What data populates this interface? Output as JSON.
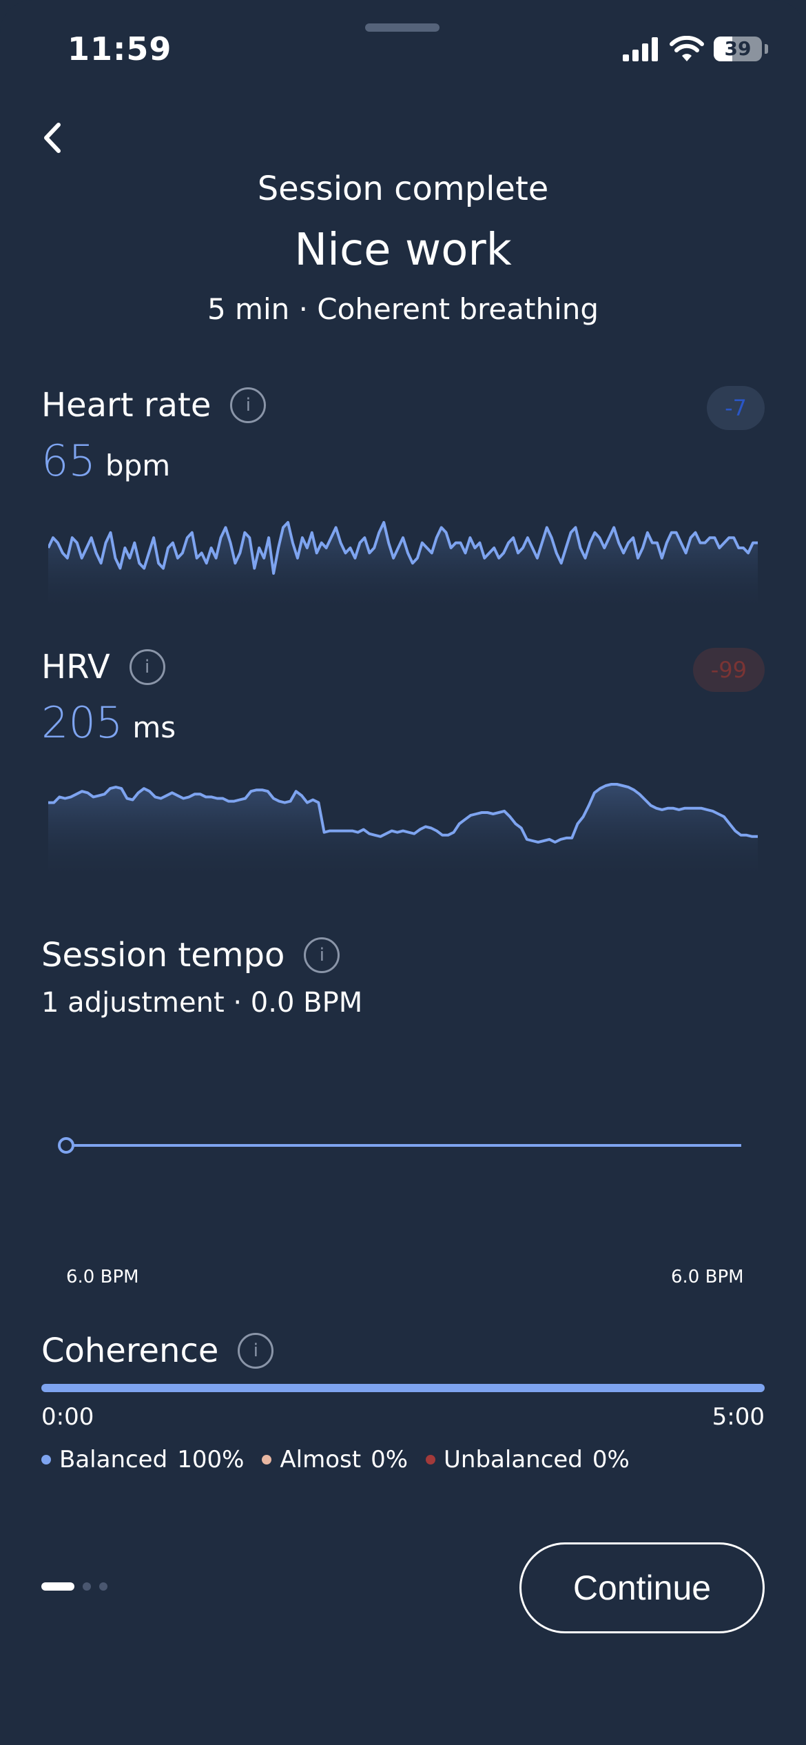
{
  "status_bar": {
    "time": "11:59",
    "battery": "39",
    "battery_level": 0.39
  },
  "header": {
    "line1": "Session complete",
    "title": "Nice work",
    "subtitle": "5 min · Coherent breathing"
  },
  "heart_rate": {
    "title": "Heart rate",
    "delta": "-7",
    "value": "65",
    "unit": "bpm",
    "chart_data": {
      "type": "line",
      "values": [
        62,
        64,
        63,
        61,
        60,
        64,
        63,
        60,
        62,
        64,
        61,
        59,
        63,
        65,
        60,
        58,
        62,
        60,
        63,
        59,
        58,
        61,
        64,
        59,
        58,
        62,
        63,
        60,
        61,
        64,
        65,
        60,
        61,
        59,
        62,
        60,
        64,
        66,
        63,
        59,
        61,
        65,
        64,
        58,
        62,
        60,
        64,
        57,
        62,
        66,
        67,
        63,
        60,
        64,
        62,
        65,
        61,
        63,
        62,
        64,
        66,
        63,
        61,
        62,
        60,
        63,
        64,
        61,
        62,
        65,
        67,
        63,
        60,
        62,
        64,
        61,
        59,
        60,
        63,
        62,
        61,
        64,
        66,
        65,
        62,
        63,
        63,
        61,
        64,
        62,
        63,
        60,
        61,
        62,
        60,
        61,
        63,
        64,
        61,
        62,
        64,
        62,
        60,
        63,
        66,
        64,
        61,
        59,
        62,
        65,
        66,
        62,
        60,
        63,
        65,
        64,
        62,
        64,
        66,
        63,
        61,
        63,
        64,
        60,
        62,
        65,
        63,
        63,
        60,
        63,
        65,
        65,
        63,
        61,
        64,
        65,
        63,
        63,
        64,
        64,
        62,
        63,
        64,
        64,
        62,
        62,
        61,
        63,
        63
      ]
    }
  },
  "hrv": {
    "title": "HRV",
    "delta": "-99",
    "value": "205",
    "unit": "ms",
    "chart_data": {
      "type": "line",
      "values": [
        180,
        180,
        184,
        183,
        184,
        186,
        188,
        187,
        184,
        185,
        186,
        190,
        191,
        190,
        183,
        182,
        187,
        190,
        188,
        184,
        183,
        185,
        187,
        185,
        183,
        184,
        186,
        186,
        184,
        184,
        183,
        183,
        181,
        181,
        182,
        183,
        188,
        189,
        189,
        188,
        183,
        181,
        180,
        181,
        188,
        185,
        180,
        182,
        180,
        159,
        160,
        160,
        160,
        160,
        160,
        159,
        161,
        158,
        157,
        156,
        158,
        160,
        159,
        160,
        159,
        158,
        161,
        163,
        162,
        160,
        157,
        157,
        159,
        165,
        168,
        171,
        172,
        173,
        173,
        172,
        173,
        174,
        170,
        165,
        162,
        154,
        153,
        152,
        153,
        154,
        152,
        154,
        155,
        155,
        165,
        170,
        178,
        187,
        190,
        192,
        193,
        193,
        192,
        191,
        189,
        186,
        182,
        178,
        176,
        175,
        176,
        176,
        175,
        176,
        176,
        176,
        176,
        175,
        174,
        172,
        170,
        165,
        160,
        157,
        157,
        156,
        156
      ]
    }
  },
  "tempo": {
    "title": "Session tempo",
    "subtitle": "1 adjustment · 0.0 BPM",
    "chart_data": {
      "type": "line",
      "x_labels": [
        "6.0 BPM",
        "6.0 BPM"
      ],
      "values": [
        6.0,
        6.0
      ]
    }
  },
  "coherence": {
    "title": "Coherence",
    "start_time": "0:00",
    "end_time": "5:00",
    "legend": [
      {
        "label": "Balanced",
        "pct": "100%",
        "color": "#7ea4f0"
      },
      {
        "label": "Almost",
        "pct": "0%",
        "color": "#e8b7a2"
      },
      {
        "label": "Unbalanced",
        "pct": "0%",
        "color": "#a23a3a"
      }
    ]
  },
  "footer": {
    "continue_label": "Continue",
    "page_count": 3,
    "active_page": 0
  },
  "colors": {
    "background": "#1f2c40",
    "accent": "#7ea4f0"
  }
}
